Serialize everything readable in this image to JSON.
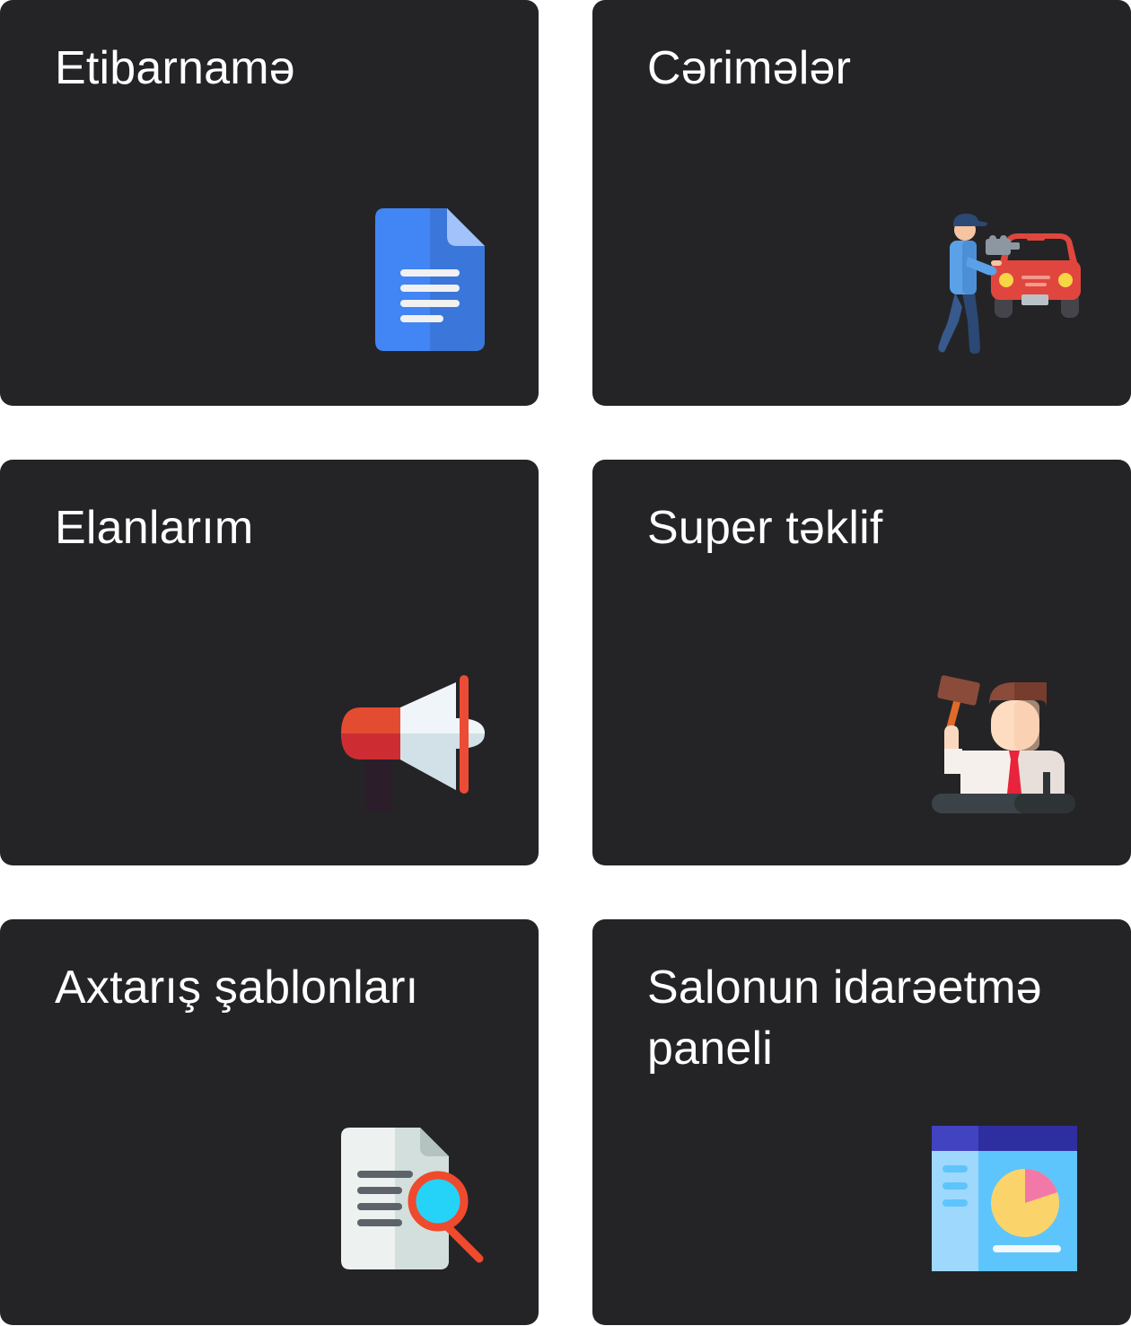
{
  "cards": [
    {
      "title": "Etibarnamə",
      "icon": "document-icon"
    },
    {
      "title": "Cərimələr",
      "icon": "traffic-fine-icon"
    },
    {
      "title": "Elanlarım",
      "icon": "megaphone-icon"
    },
    {
      "title": "Super təklif",
      "icon": "auction-icon"
    },
    {
      "title": "Axtarış şablonları",
      "icon": "document-search-icon"
    },
    {
      "title": "Salonun idarəetmə paneli",
      "icon": "dashboard-icon"
    }
  ],
  "colors": {
    "card_background": "#242426",
    "page_background": "#ffffff",
    "title_text": "#ffffff"
  }
}
